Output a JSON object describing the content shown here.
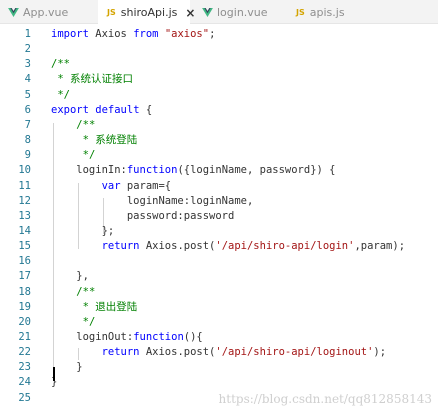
{
  "tabs": [
    {
      "label": "App.vue",
      "type": "vue",
      "active": false
    },
    {
      "label": "shiroApi.js",
      "type": "js",
      "active": true,
      "close": "×"
    },
    {
      "label": "login.vue",
      "type": "vue",
      "active": false
    },
    {
      "label": "apis.js",
      "type": "js",
      "active": false
    }
  ],
  "js_badge": "JS",
  "colors": {
    "keyword": "#0000ff",
    "string": "#a31515",
    "comment": "#008000",
    "text": "#333333",
    "line_number": "#237893",
    "vue_icon": "#41b883",
    "js_icon": "#d4a400"
  },
  "lines": [
    {
      "n": "1",
      "tokens": [
        [
          "kw",
          "import"
        ],
        [
          "plain",
          " Axios "
        ],
        [
          "kw",
          "from"
        ],
        [
          "plain",
          " "
        ],
        [
          "str",
          "\"axios\""
        ],
        [
          "plain",
          ";"
        ]
      ]
    },
    {
      "n": "2",
      "tokens": []
    },
    {
      "n": "3",
      "tokens": [
        [
          "com",
          "/**"
        ]
      ]
    },
    {
      "n": "4",
      "tokens": [
        [
          "com",
          " * 系统认证接口"
        ]
      ]
    },
    {
      "n": "5",
      "tokens": [
        [
          "com",
          " */"
        ]
      ]
    },
    {
      "n": "6",
      "tokens": [
        [
          "kw",
          "export"
        ],
        [
          "plain",
          " "
        ],
        [
          "kw",
          "default"
        ],
        [
          "plain",
          " {"
        ]
      ]
    },
    {
      "n": "7",
      "tokens": [
        [
          "plain",
          "    "
        ],
        [
          "com",
          "/**"
        ]
      ]
    },
    {
      "n": "8",
      "tokens": [
        [
          "plain",
          "    "
        ],
        [
          "com",
          " * 系统登陆"
        ]
      ]
    },
    {
      "n": "9",
      "tokens": [
        [
          "plain",
          "    "
        ],
        [
          "com",
          " */"
        ]
      ]
    },
    {
      "n": "10",
      "tokens": [
        [
          "plain",
          "    loginIn:"
        ],
        [
          "kw",
          "function"
        ],
        [
          "plain",
          "({loginName, password}) {"
        ]
      ]
    },
    {
      "n": "11",
      "tokens": [
        [
          "plain",
          "        "
        ],
        [
          "kw",
          "var"
        ],
        [
          "plain",
          " param={"
        ]
      ]
    },
    {
      "n": "12",
      "tokens": [
        [
          "plain",
          "            loginName:loginName,"
        ]
      ]
    },
    {
      "n": "13",
      "tokens": [
        [
          "plain",
          "            password:password"
        ]
      ]
    },
    {
      "n": "14",
      "tokens": [
        [
          "plain",
          "        };"
        ]
      ]
    },
    {
      "n": "15",
      "tokens": [
        [
          "plain",
          "        "
        ],
        [
          "kw",
          "return"
        ],
        [
          "plain",
          " Axios.post("
        ],
        [
          "str",
          "'/api/shiro-api/login'"
        ],
        [
          "plain",
          ",param);"
        ]
      ]
    },
    {
      "n": "16",
      "tokens": []
    },
    {
      "n": "17",
      "tokens": [
        [
          "plain",
          "    },"
        ]
      ]
    },
    {
      "n": "18",
      "tokens": [
        [
          "plain",
          "    "
        ],
        [
          "com",
          "/**"
        ]
      ]
    },
    {
      "n": "19",
      "tokens": [
        [
          "plain",
          "    "
        ],
        [
          "com",
          " * 退出登陆"
        ]
      ]
    },
    {
      "n": "20",
      "tokens": [
        [
          "plain",
          "    "
        ],
        [
          "com",
          " */"
        ]
      ]
    },
    {
      "n": "21",
      "tokens": [
        [
          "plain",
          "    loginOut:"
        ],
        [
          "kw",
          "function"
        ],
        [
          "plain",
          "(){"
        ]
      ]
    },
    {
      "n": "22",
      "tokens": [
        [
          "plain",
          "        "
        ],
        [
          "kw",
          "return"
        ],
        [
          "plain",
          " Axios.post("
        ],
        [
          "str",
          "'/api/shiro-api/loginout'"
        ],
        [
          "plain",
          ");"
        ]
      ]
    },
    {
      "n": "23",
      "tokens": [
        [
          "plain",
          "    }"
        ]
      ]
    },
    {
      "n": "24",
      "tokens": [
        [
          "plain",
          "}"
        ]
      ]
    },
    {
      "n": "25",
      "tokens": []
    }
  ],
  "watermark": "https://blog.csdn.net/qq812858143"
}
